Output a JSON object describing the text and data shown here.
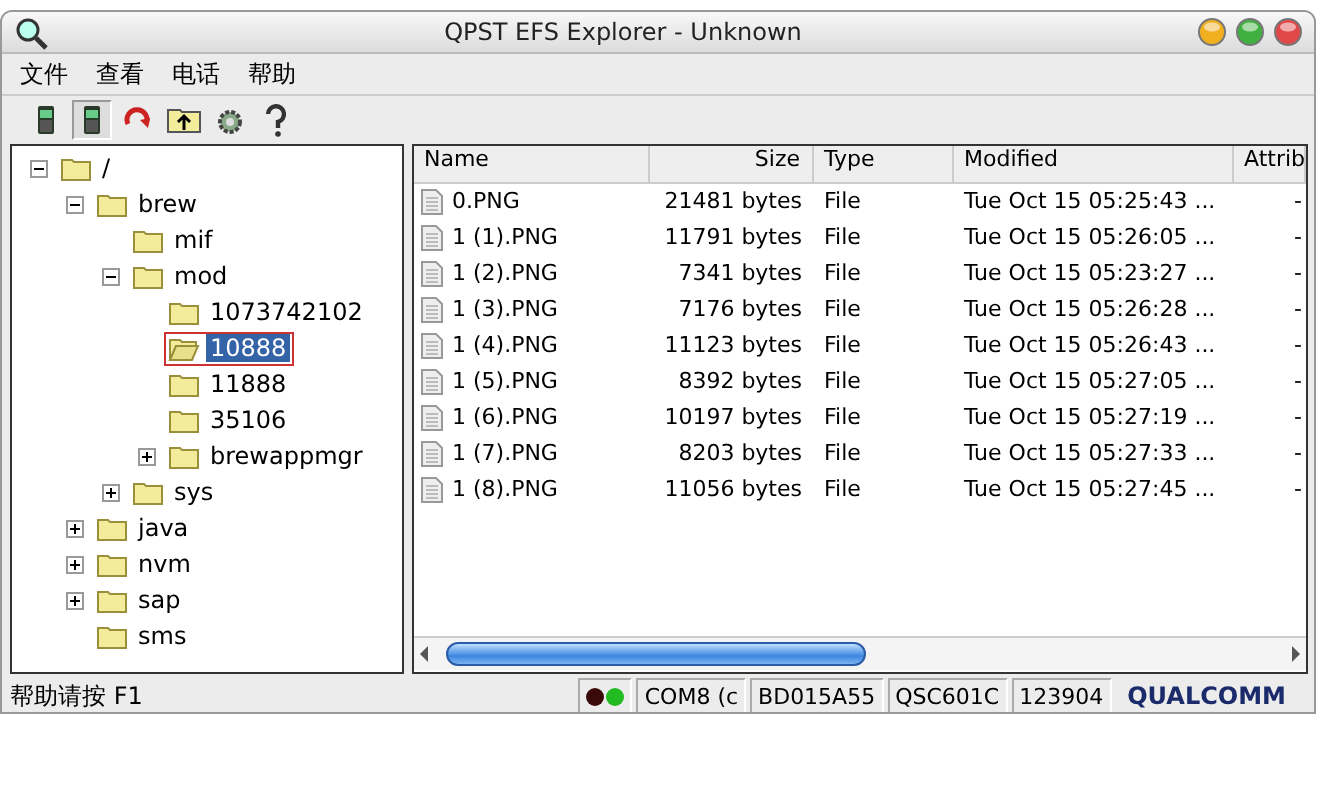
{
  "window": {
    "title": "QPST EFS Explorer - Unknown"
  },
  "menu": [
    {
      "label": "文件"
    },
    {
      "label": "查看"
    },
    {
      "label": "电话"
    },
    {
      "label": "帮助"
    }
  ],
  "toolbar": [
    {
      "kind": "phone",
      "selected": false
    },
    {
      "kind": "phone",
      "selected": true
    },
    {
      "kind": "refresh",
      "selected": false
    },
    {
      "kind": "folder-up",
      "selected": false
    },
    {
      "kind": "settings",
      "selected": false
    },
    {
      "kind": "help",
      "selected": false
    }
  ],
  "tree": [
    {
      "label": "/",
      "expanded": true,
      "selected": false,
      "outlined": false,
      "children": [
        {
          "label": "brew",
          "expanded": true,
          "selected": false,
          "outlined": false,
          "children": [
            {
              "label": "mif",
              "selected": false,
              "outlined": false
            },
            {
              "label": "mod",
              "expanded": true,
              "selected": false,
              "outlined": false,
              "children": [
                {
                  "label": "1073742102",
                  "selected": false,
                  "outlined": false
                },
                {
                  "label": "10888",
                  "selected": true,
                  "outlined": true
                },
                {
                  "label": "11888",
                  "selected": false,
                  "outlined": false
                },
                {
                  "label": "35106",
                  "selected": false,
                  "outlined": false
                },
                {
                  "label": "brewappmgr",
                  "expanded": false,
                  "selected": false,
                  "outlined": false
                }
              ]
            },
            {
              "label": "sys",
              "expanded": false,
              "selected": false,
              "outlined": false
            }
          ]
        },
        {
          "label": "java",
          "expanded": false,
          "selected": false,
          "outlined": false
        },
        {
          "label": "nvm",
          "expanded": false,
          "selected": false,
          "outlined": false
        },
        {
          "label": "sap",
          "expanded": false,
          "selected": false,
          "outlined": false
        },
        {
          "label": "sms",
          "selected": false,
          "outlined": false
        }
      ]
    }
  ],
  "table": {
    "columns": [
      "Name",
      "Size",
      "Type",
      "Modified",
      "Attrib"
    ],
    "rows": [
      {
        "name": "0.PNG",
        "size": "21481 bytes",
        "type": "File",
        "modified": "Tue Oct 15 05:25:43 ...",
        "attrib": "-"
      },
      {
        "name": "1 (1).PNG",
        "size": "11791 bytes",
        "type": "File",
        "modified": "Tue Oct 15 05:26:05 ...",
        "attrib": "-"
      },
      {
        "name": "1 (2).PNG",
        "size": "7341 bytes",
        "type": "File",
        "modified": "Tue Oct 15 05:23:27 ...",
        "attrib": "-"
      },
      {
        "name": "1 (3).PNG",
        "size": "7176 bytes",
        "type": "File",
        "modified": "Tue Oct 15 05:26:28 ...",
        "attrib": "-"
      },
      {
        "name": "1 (4).PNG",
        "size": "11123 bytes",
        "type": "File",
        "modified": "Tue Oct 15 05:26:43 ...",
        "attrib": "-"
      },
      {
        "name": "1 (5).PNG",
        "size": "8392 bytes",
        "type": "File",
        "modified": "Tue Oct 15 05:27:05 ...",
        "attrib": "-"
      },
      {
        "name": "1 (6).PNG",
        "size": "10197 bytes",
        "type": "File",
        "modified": "Tue Oct 15 05:27:19 ...",
        "attrib": "-"
      },
      {
        "name": "1 (7).PNG",
        "size": "8203 bytes",
        "type": "File",
        "modified": "Tue Oct 15 05:27:33 ...",
        "attrib": "-"
      },
      {
        "name": "1 (8).PNG",
        "size": "11056 bytes",
        "type": "File",
        "modified": "Tue Oct 15 05:27:45 ...",
        "attrib": "-"
      }
    ]
  },
  "status_bar": {
    "help": "帮助请按 F1",
    "indicators": [
      {
        "color": "#3a0a0a"
      },
      {
        "color": "#22bb22"
      }
    ],
    "port": "COM8 (c",
    "id": "BD015A55",
    "chip": "QSC601C",
    "number": "123904",
    "logo": "QUALCOMM"
  }
}
